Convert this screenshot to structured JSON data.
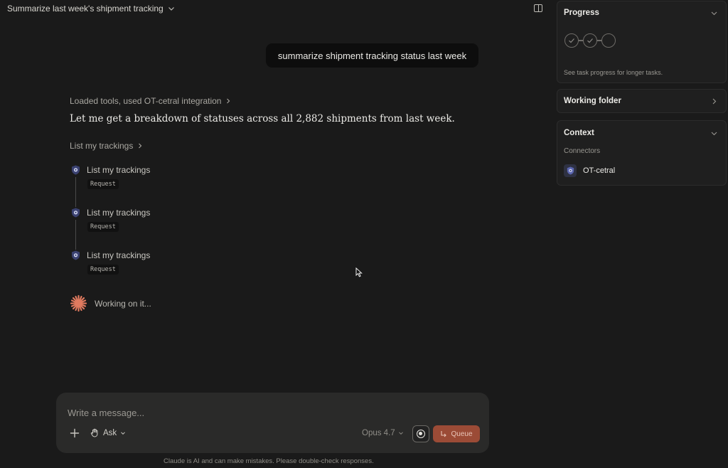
{
  "header": {
    "title": "Summarize last week's shipment tracking"
  },
  "conversation": {
    "user_message": "summarize shipment tracking status last week",
    "tools_summary": "Loaded tools, used OT-cetral integration",
    "assistant_text": "Let me get a breakdown of statuses across all 2,882 shipments from last week.",
    "tool_group_label": "List my trackings",
    "tool_calls": [
      {
        "name": "List my trackings",
        "tag": "Request"
      },
      {
        "name": "List my trackings",
        "tag": "Request"
      },
      {
        "name": "List my trackings",
        "tag": "Request"
      }
    ],
    "status_text": "Working on it..."
  },
  "composer": {
    "placeholder": "Write a message...",
    "mode_label": "Ask",
    "model_label": "Opus 4.7",
    "queue_label": "Queue",
    "disclaimer": "Claude is AI and can make mistakes. Please double-check responses."
  },
  "sidebar": {
    "progress": {
      "title": "Progress",
      "steps": [
        "done",
        "done",
        "pending"
      ],
      "note": "See task progress for longer tasks."
    },
    "working_folder": {
      "title": "Working folder"
    },
    "context": {
      "title": "Context",
      "connectors_label": "Connectors",
      "connectors": [
        {
          "name": "OT-cetral"
        }
      ]
    }
  },
  "colors": {
    "background": "#1a1a1a",
    "accent_queue": "#9b4b36",
    "working_spark": "#e07a5f",
    "tool_icon": "#3a4170"
  }
}
